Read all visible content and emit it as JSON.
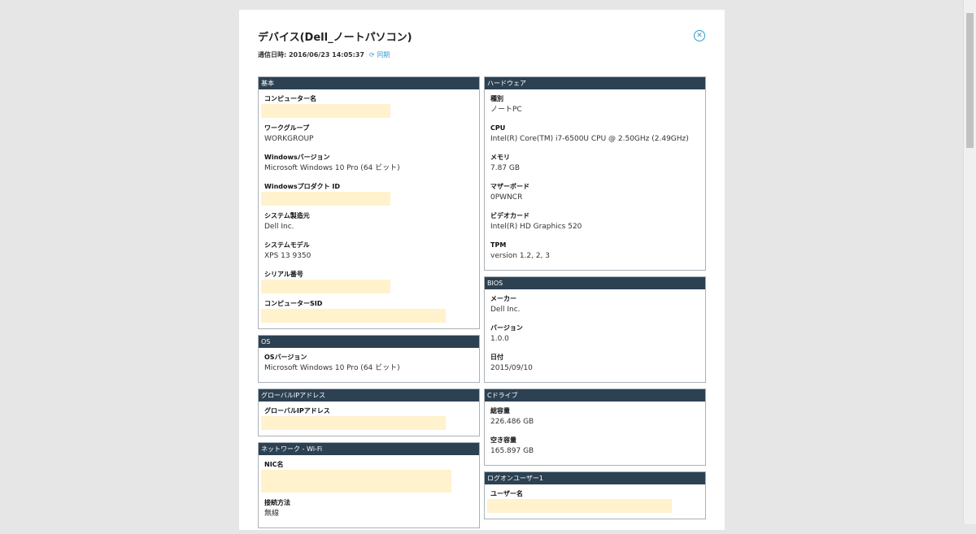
{
  "title": "デバイス(Dell_ノートパソコン)",
  "comm": {
    "label": "通信日時: 2016/06/23 14:05:37",
    "sync_label": "同期"
  },
  "left_cards": [
    {
      "header": "基本",
      "fields": [
        {
          "label": "コンピューター名",
          "value": "",
          "masked": true
        },
        {
          "label": "ワークグループ",
          "value": "WORKGROUP"
        },
        {
          "label": "Windowsバージョン",
          "value": "Microsoft Windows 10 Pro (64 ビット)"
        },
        {
          "label": "Windowsプロダクト ID",
          "value": "",
          "masked": true
        },
        {
          "label": "システム製造元",
          "value": "Dell Inc."
        },
        {
          "label": "システムモデル",
          "value": "XPS 13 9350"
        },
        {
          "label": "シリアル番号",
          "value": "",
          "masked": true
        },
        {
          "label": "コンピューターSID",
          "value": "",
          "masked": true,
          "wide": true
        }
      ]
    },
    {
      "header": "OS",
      "fields": [
        {
          "label": "OSバージョン",
          "value": "Microsoft Windows 10 Pro (64 ビット)"
        }
      ]
    },
    {
      "header": "グローバルIPアドレス",
      "fields": [
        {
          "label": "グローバルIPアドレス",
          "value": "",
          "masked": true,
          "wide": true
        }
      ]
    },
    {
      "header": "ネットワーク - Wi-Fi",
      "fields": [
        {
          "label": "NIC名",
          "value": "",
          "masked": true,
          "wider": true
        },
        {
          "label": "接続方法",
          "value": "無線"
        }
      ]
    }
  ],
  "right_cards": [
    {
      "header": "ハードウェア",
      "fields": [
        {
          "label": "種別",
          "value": "ノートPC"
        },
        {
          "label": "CPU",
          "value": "Intel(R) Core(TM) i7-6500U CPU @ 2.50GHz (2.49GHz)"
        },
        {
          "label": "メモリ",
          "value": "7.87 GB"
        },
        {
          "label": "マザーボード",
          "value": "0PWNCR"
        },
        {
          "label": "ビデオカード",
          "value": "Intel(R) HD Graphics 520"
        },
        {
          "label": "TPM",
          "value": "version 1.2, 2, 3"
        }
      ]
    },
    {
      "header": "BIOS",
      "fields": [
        {
          "label": "メーカー",
          "value": "Dell Inc."
        },
        {
          "label": "バージョン",
          "value": "1.0.0"
        },
        {
          "label": "日付",
          "value": "2015/09/10"
        }
      ]
    },
    {
      "header": "Cドライブ",
      "fields": [
        {
          "label": "総容量",
          "value": "226.486 GB"
        },
        {
          "label": "空き容量",
          "value": "165.897 GB"
        }
      ]
    },
    {
      "header": "ログオンユーザー1",
      "fields": [
        {
          "label": "ユーザー名",
          "value": "",
          "masked": true,
          "wide": true
        }
      ]
    }
  ]
}
